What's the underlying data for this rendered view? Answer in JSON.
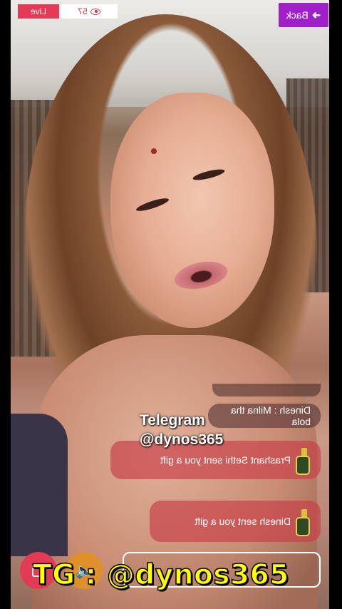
{
  "header": {
    "live_label": "Live",
    "viewer_count": "57",
    "viewer_icon": "eye-icon",
    "back_label": "Back",
    "back_icon": "arrow-left-icon"
  },
  "chat": {
    "messages": [
      {
        "text": "Dinesh : Milna tha bola"
      },
      {
        "text": "Prashant Sethi sent you a gift",
        "icon": "bottle-icon"
      },
      {
        "text": "Dinesh sent you a gift",
        "icon": "bottle-icon"
      }
    ]
  },
  "overlay": {
    "line1": "Telegram",
    "line2": "@dynos365"
  },
  "footer": {
    "watermark": "TG : @dynos365",
    "gift_icon": "gift-icon",
    "mute_icon": "speaker-mute-icon"
  },
  "colors": {
    "live": "#e33a55",
    "back": "#a020c8",
    "watermark": "#ffff00"
  }
}
